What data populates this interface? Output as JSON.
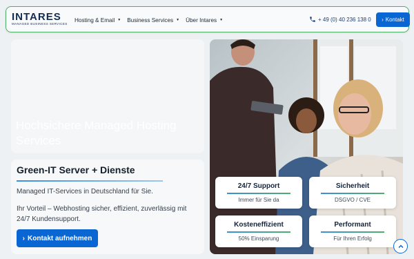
{
  "header": {
    "logo_main": "INTARES",
    "logo_sub": "MANAGED BUSINESS SERVICES",
    "nav": [
      {
        "label": "Hosting & Email"
      },
      {
        "label": "Business Services"
      },
      {
        "label": "Über Intares"
      }
    ],
    "phone": "+ 49 (0) 40 236 138 0",
    "contact_label": "Kontakt"
  },
  "hero": {
    "title": "Hochsichere Managed Hosting Services"
  },
  "info": {
    "title": "Green-IT Server + Dienste",
    "subtitle": "Managed IT-Services in Deutschland für Sie.",
    "text": "Ihr Vorteil – Webhosting sicher, effizient, zuverlässig mit 24/7 Kundensupport.",
    "cta_label": "Kontakt aufnehmen"
  },
  "features": [
    {
      "title": "24/7 Support",
      "sub": "Immer für Sie da"
    },
    {
      "title": "Sicherheit",
      "sub": "DSGVO / CVE"
    },
    {
      "title": "Kosteneffizient",
      "sub": "50% Einsparung"
    },
    {
      "title": "Performant",
      "sub": "Für Ihren Erfolg"
    }
  ],
  "colors": {
    "primary": "#0a66d3",
    "brand_navy": "#122c52",
    "accent_green": "#4fae68"
  },
  "icons": {
    "phone": "phone-icon",
    "caret": "caret-down-icon",
    "chevron": "chevron-right-icon",
    "scroll_top": "chevron-up-icon"
  }
}
